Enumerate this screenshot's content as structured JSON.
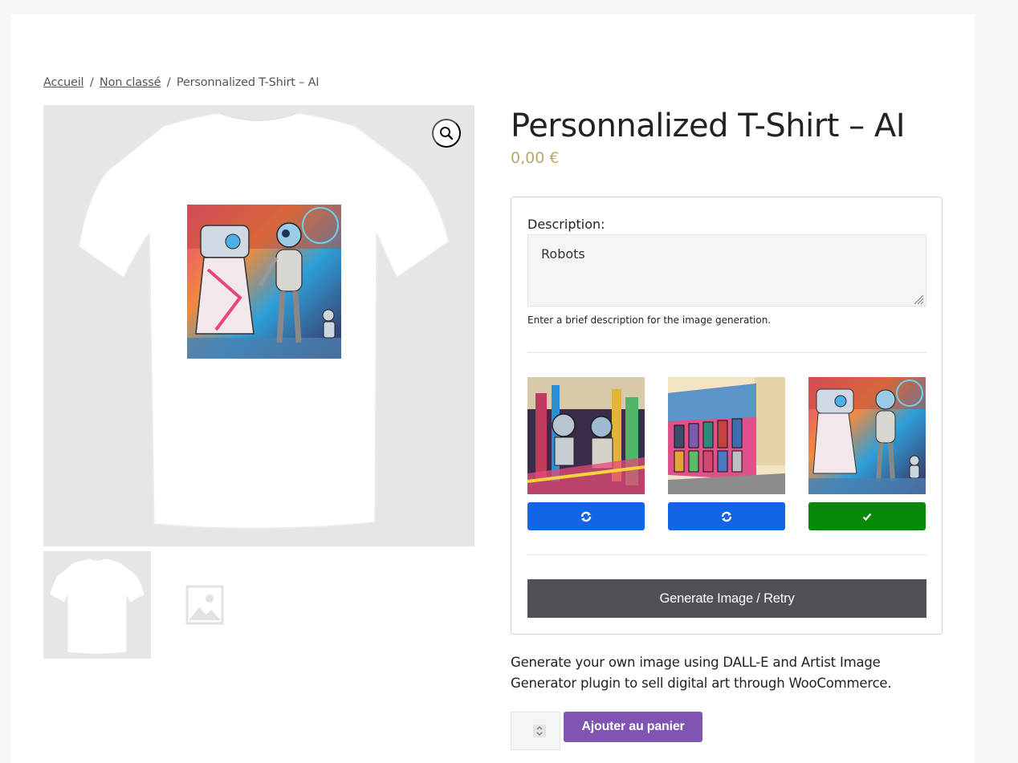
{
  "breadcrumb": {
    "home": "Accueil",
    "sep1": "/",
    "category": "Non classé",
    "sep2": "/",
    "current": "Personnalized T-Shirt – AI"
  },
  "product": {
    "title": "Personnalized T-Shirt – AI",
    "price": "0,00 €",
    "description": "Generate your own image using DALL-E and Artist Image Generator plugin to sell digital art through WooCommerce."
  },
  "generator": {
    "description_label": "Description:",
    "description_value": "Robots",
    "help_text": "Enter a brief description for the image generation.",
    "generate_label": "Generate Image / Retry",
    "image_buttons": [
      {
        "icon": "refresh-icon",
        "state": "retry"
      },
      {
        "icon": "refresh-icon",
        "state": "retry"
      },
      {
        "icon": "check-icon",
        "state": "selected"
      }
    ]
  },
  "cart": {
    "quantity": "1",
    "add_label": "Ajouter au panier"
  },
  "colors": {
    "retry_button": "#1266e6",
    "selected_button": "#088a08",
    "add_to_cart": "#7f54b3",
    "price": "#b8a96a",
    "generate_button": "#4f5156"
  }
}
